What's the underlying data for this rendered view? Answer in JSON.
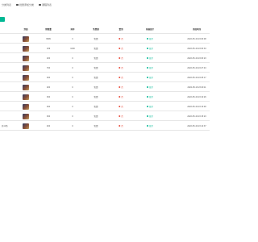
{
  "tabs": [
    {
      "label": "分类列表",
      "icon": "list-icon"
    },
    {
      "label": "批量添加分类",
      "icon": "add-icon"
    },
    {
      "label": "课程列表",
      "icon": "folder-icon"
    }
  ],
  "toolbar": {
    "add_button_color": "#00b894"
  },
  "table": {
    "headers": [
      "封面",
      "销售量",
      "排序",
      "免费课",
      "置顶",
      "前端显示",
      "添加时间"
    ],
    "rows": [
      {
        "sales": "9999",
        "sort": "0",
        "free": "免费",
        "top": "否",
        "status": "显示",
        "time": "2022-05-19 23:03:08"
      },
      {
        "sales": "199",
        "sort": "1000",
        "free": "免费",
        "top": "否",
        "status": "显示",
        "time": "2022-05-19 23:03:33"
      },
      {
        "sales": "200",
        "sort": "0",
        "free": "免费",
        "top": "否",
        "status": "显示",
        "time": "2022-05-19 23:03:23"
      },
      {
        "sales": "700",
        "sort": "0",
        "free": "免费",
        "top": "否",
        "status": "显示",
        "time": "2022-05-19 23:27:43"
      },
      {
        "sales": "300",
        "sort": "0",
        "free": "免费",
        "top": "否",
        "status": "显示",
        "time": "2022-05-19 23:25:17"
      },
      {
        "sales": "200",
        "sort": "0",
        "free": "免费",
        "top": "否",
        "status": "显示",
        "time": "2022-05-19 23:20:11"
      },
      {
        "sales": "300",
        "sort": "0",
        "free": "免费",
        "top": "否",
        "status": "显示",
        "time": "2022-05-19 23:10:26"
      },
      {
        "sales": "300",
        "sort": "0",
        "free": "免费",
        "top": "否",
        "status": "显示",
        "time": "2022-05-19 23:13:48"
      },
      {
        "sales": "300",
        "sort": "0",
        "free": "免费",
        "top": "否",
        "status": "显示",
        "time": "2022-05-19 23:15:23"
      },
      {
        "sales": "400",
        "sort": "0",
        "free": "免费",
        "top": "否",
        "status": "显示",
        "time": "2022-05-19 23:14:37"
      }
    ]
  },
  "footer": {
    "text": "共10条"
  },
  "colors": {
    "no": "#e74c3c",
    "show": "#00b894"
  }
}
